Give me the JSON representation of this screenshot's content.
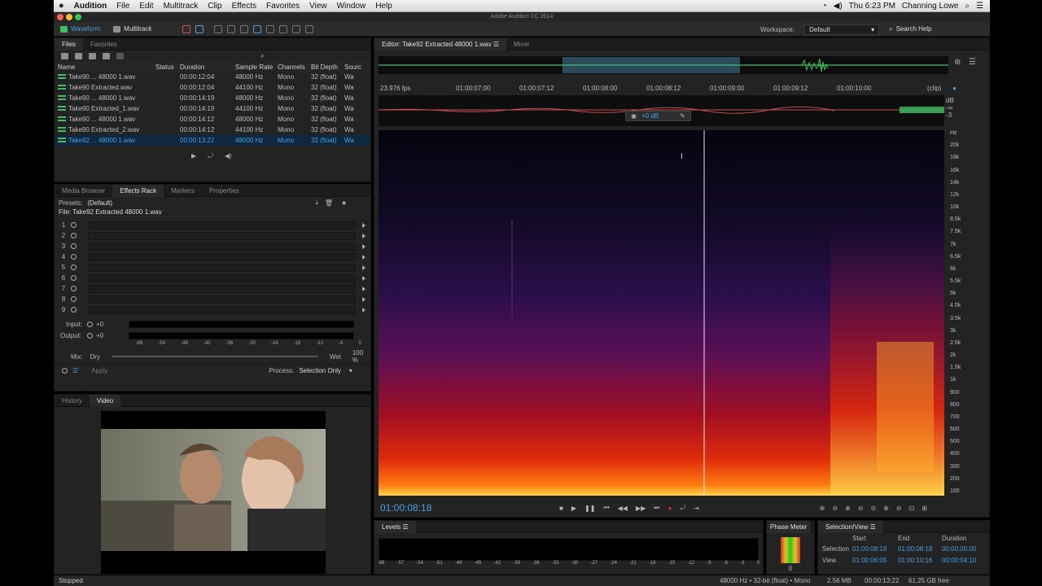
{
  "menubar": {
    "app": "Audition",
    "items": [
      "File",
      "Edit",
      "Multitrack",
      "Clip",
      "Effects",
      "Favorites",
      "View",
      "Window",
      "Help"
    ],
    "clock": "Thu 6:23 PM",
    "user": "Channing Lowe"
  },
  "window_title": "Adobe Audition CC 2014",
  "toolbar": {
    "waveform": "Waveform",
    "multitrack": "Multitrack",
    "workspace_label": "Workspace:",
    "workspace_value": "Default",
    "search": "Search Help"
  },
  "files_panel": {
    "tabs": [
      "Files",
      "Favorites"
    ],
    "headers": [
      "Name",
      "Status",
      "Duration",
      "Sample Rate",
      "Channels",
      "Bit Depth",
      "Sourc"
    ],
    "rows": [
      {
        "name": "Take90 ... 48000 1.wav",
        "status": "",
        "duration": "00:00:12:04",
        "sr": "48000 Hz",
        "ch": "Mono",
        "bd": "32 (float)",
        "src": "Wa"
      },
      {
        "name": "Take90 Extracted.wav",
        "status": "",
        "duration": "00:00:12:04",
        "sr": "44100 Hz",
        "ch": "Mono",
        "bd": "32 (float)",
        "src": "Wa"
      },
      {
        "name": "Take90 ... 48000 1.wav",
        "status": "",
        "duration": "00:00:14:19",
        "sr": "48000 Hz",
        "ch": "Mono",
        "bd": "32 (float)",
        "src": "Wa"
      },
      {
        "name": "Take90 Extracted_1.wav",
        "status": "",
        "duration": "00:00:14:19",
        "sr": "44100 Hz",
        "ch": "Mono",
        "bd": "32 (float)",
        "src": "Wa"
      },
      {
        "name": "Take90 ... 48000 1.wav",
        "status": "",
        "duration": "00:00:14:12",
        "sr": "48000 Hz",
        "ch": "Mono",
        "bd": "32 (float)",
        "src": "Wa"
      },
      {
        "name": "Take90 Extracted_2.wav",
        "status": "",
        "duration": "00:00:14:12",
        "sr": "44100 Hz",
        "ch": "Mono",
        "bd": "32 (float)",
        "src": "Wa"
      },
      {
        "name": "Take92 ... 48000 1.wav",
        "status": "",
        "duration": "00:00:13:22",
        "sr": "48000 Hz",
        "ch": "Mono",
        "bd": "32 (float)",
        "src": "Wa",
        "selected": true
      }
    ]
  },
  "effects_panel": {
    "tabs": [
      "Media Browser",
      "Effects Rack",
      "Markers",
      "Properties"
    ],
    "presets_label": "Presets:",
    "presets_value": "(Default)",
    "file_label": "File: Take92 Extracted 48000 1.wav",
    "slots": [
      "1",
      "2",
      "3",
      "4",
      "5",
      "6",
      "7",
      "8",
      "9"
    ],
    "input_label": "Input:",
    "output_label": "Output:",
    "gain_value": "+0",
    "db_scale": [
      "dB",
      "-54",
      "-48",
      "-42",
      "-36",
      "-30",
      "-24",
      "-18",
      "-12",
      "-6",
      "0"
    ],
    "mix_label": "Mix:",
    "dry": "Dry",
    "wet": "Wet",
    "wet_value": "100 %",
    "apply": "Apply",
    "process_label": "Process:",
    "process_value": "Selection Only"
  },
  "video_panel": {
    "tabs": [
      "History",
      "Video"
    ]
  },
  "editor": {
    "tabs": [
      "Editor: Take92 Extracted 48000 1.wav",
      "Mixer"
    ],
    "fps": "23.976 fps",
    "timecodes": [
      "01:00:07:00",
      "01:00:07:12",
      "01:00:08:00",
      "01:00:08:12",
      "01:00:09:00",
      "01:00:09:12",
      "01:00:10:00"
    ],
    "clip": "(clip)",
    "db_side": [
      "dB",
      "-∞",
      "-3"
    ],
    "hud_gain": "+0 dB",
    "freq_labels": [
      "Hz",
      "20k",
      "18k",
      "16k",
      "14k",
      "12k",
      "10k",
      "8.5k",
      "7.5k",
      "7k",
      "6.5k",
      "6k",
      "5.5k",
      "5k",
      "4.5k",
      "3.5k",
      "3k",
      "2.5k",
      "2k",
      "1.5k",
      "1k",
      "900",
      "800",
      "700",
      "600",
      "500",
      "400",
      "300",
      "200",
      "100"
    ],
    "current_time": "01:00:08:18"
  },
  "levels_panel": {
    "title": "Levels",
    "scale": [
      "dB",
      "-57",
      "-54",
      "-51",
      "-48",
      "-45",
      "-42",
      "-39",
      "-36",
      "-33",
      "-30",
      "-27",
      "-24",
      "-21",
      "-18",
      "-15",
      "-12",
      "-9",
      "-6",
      "-3",
      "0"
    ]
  },
  "phase_meter": {
    "title": "Phase Meter",
    "value": "0"
  },
  "selection_view": {
    "title": "Selection/View",
    "headers": [
      "Start",
      "End",
      "Duration"
    ],
    "rows": [
      {
        "label": "Selection",
        "start": "01:00:08:18",
        "end": "01:00:08:18",
        "duration": "00:00:00:00"
      },
      {
        "label": "View",
        "start": "01:00:06:05",
        "end": "01:00:10:16",
        "duration": "00:00:04:10"
      }
    ]
  },
  "statusbar": {
    "state": "Stopped",
    "format": "48000 Hz • 32-bit (float) • Mono",
    "size": "2.56 MB",
    "duration": "00:00:13:22",
    "free": "61.25 GB free"
  },
  "colors": {
    "accent": "#4a9fe0",
    "waveform_green": "#3fbf63"
  }
}
